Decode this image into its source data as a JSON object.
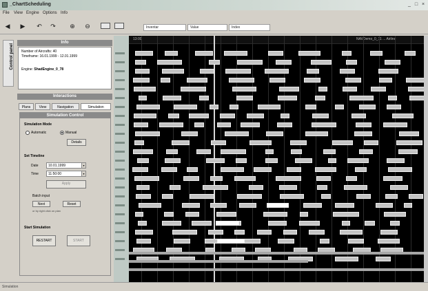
{
  "window": {
    "title": "_ChartScheduling"
  },
  "menu": [
    "File",
    "View",
    "Engine",
    "Options",
    "Info"
  ],
  "toolbar": {
    "fields": [
      {
        "label": "Inventar"
      },
      {
        "label": "Value"
      },
      {
        "label": "Index"
      }
    ]
  },
  "side_tab": {
    "label": "Control panel"
  },
  "info_panel": {
    "header": "Info",
    "lines": [
      "Number of Aircrafts: 40",
      "Timeframe: 16.01.1999 - 12.01.1999"
    ],
    "engine_label": "Engine:",
    "engine_value": "ShadEngine_0_78"
  },
  "interactions": {
    "header": "Interactions",
    "tabs": [
      "Plans",
      "View",
      "Navigation",
      "Simulation"
    ]
  },
  "simulation": {
    "header": "Simulation Control",
    "mode_title": "Simulation Mode",
    "mode_auto": "Automatic",
    "mode_manual": "Manual",
    "mode_selected": "Manual",
    "details_btn": "Details",
    "timeline_title": "Set Timeline",
    "date_label": "Date",
    "date_value": "10.01.1999",
    "time_label": "Time",
    "time_value": "11:50:00",
    "apply_btn": "Apply",
    "batch_label": "Batch input",
    "next_btn": "Next",
    "reset_btn": "Reset",
    "hint": "or by right click on plan",
    "start_title": "Start Simulation",
    "restart_btn": "RESTART",
    "start_btn": "START"
  },
  "gantt": {
    "left_label": "13:00",
    "right_label": "NAVDemo_0_11 ... Airline"
  },
  "status": {
    "text": "Simulation"
  },
  "colors": {
    "chart_bg": "#000000",
    "bar": "#c4c4c4",
    "bar_highlight": "#fdfdfd"
  }
}
